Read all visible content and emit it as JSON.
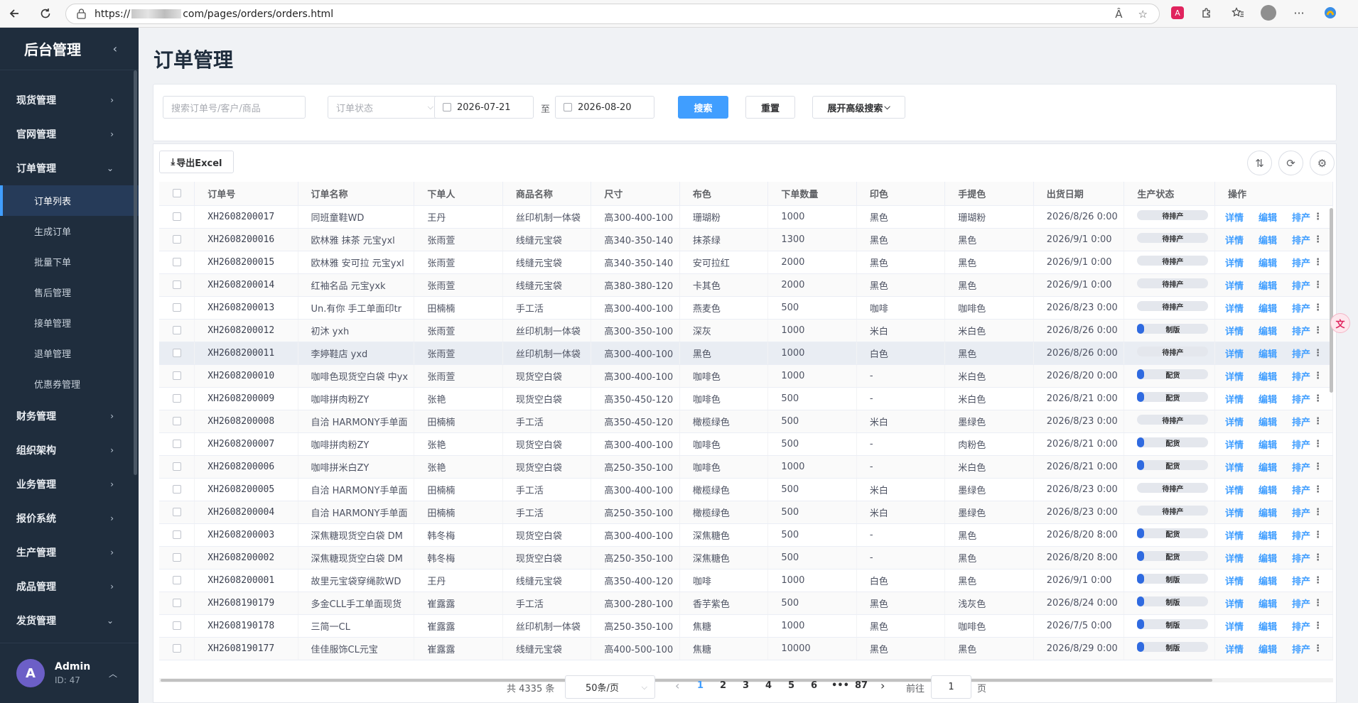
{
  "browser": {
    "url_prefix": "https://",
    "url_suffix": "com/pages/orders/orders.html",
    "read_aloud": "Â",
    "favorite": "☆",
    "more": "···"
  },
  "sidebar": {
    "title": "后台管理",
    "menu": [
      {
        "label": "现货管理",
        "arrow": "›"
      },
      {
        "label": "官网管理",
        "arrow": "›"
      },
      {
        "label": "订单管理",
        "arrow": "⌄"
      }
    ],
    "submenu": [
      "订单列表",
      "生成订单",
      "批量下单",
      "售后管理",
      "接单管理",
      "退单管理",
      "优惠券管理"
    ],
    "menu2": [
      {
        "label": "财务管理",
        "arrow": "›"
      },
      {
        "label": "组织架构",
        "arrow": "›"
      },
      {
        "label": "业务管理",
        "arrow": "›"
      },
      {
        "label": "报价系统",
        "arrow": "›"
      },
      {
        "label": "生产管理",
        "arrow": "›"
      },
      {
        "label": "成品管理",
        "arrow": "›"
      },
      {
        "label": "发货管理",
        "arrow": "⌄"
      }
    ],
    "user": {
      "initial": "A",
      "name": "Admin",
      "id": "ID: 47"
    }
  },
  "page": {
    "title": "订单管理"
  },
  "search": {
    "keyword_placeholder": "搜索订单号/客户/商品",
    "status_placeholder": "订单状态",
    "date_from": "2026-07-21",
    "to_label": "至",
    "date_to": "2026-08-20",
    "search_btn": "搜索",
    "reset_btn": "重置",
    "advanced_btn": "展开高级搜索"
  },
  "toolbar": {
    "export_label": "导出Excel"
  },
  "table": {
    "headers": [
      "订单号",
      "订单名称",
      "下单人",
      "商品名称",
      "尺寸",
      "布色",
      "下单数量",
      "印色",
      "手提色",
      "出货日期",
      "生产状态",
      "操作"
    ],
    "ops": [
      "详情",
      "编辑",
      "排产"
    ],
    "rows": [
      [
        "XH2608200017",
        "同班童鞋WD",
        "王丹",
        "丝印机制一体袋",
        "高300-400-100",
        "珊瑚粉",
        "1000",
        "黑色",
        "珊瑚粉",
        "2026/8/26 0:00",
        "待排产",
        0
      ],
      [
        "XH2608200016",
        "欧林雅 抹茶 元宝yxl",
        "张雨萱",
        "线缝元宝袋",
        "高340-350-140",
        "抹茶绿",
        "1300",
        "黑色",
        "黑色",
        "2026/9/1 0:00",
        "待排产",
        0
      ],
      [
        "XH2608200015",
        "欧林雅 安可拉 元宝yxl",
        "张雨萱",
        "线缝元宝袋",
        "高340-350-140",
        "安可拉红",
        "2000",
        "黑色",
        "黑色",
        "2026/9/1 0:00",
        "待排产",
        0
      ],
      [
        "XH2608200014",
        "红袖名品 元宝yxk",
        "张雨萱",
        "线缝元宝袋",
        "高380-380-120",
        "卡其色",
        "2000",
        "黑色",
        "黑色",
        "2026/9/1 0:00",
        "待排产",
        0
      ],
      [
        "XH2608200013",
        "Un.有你 手工单面印tr",
        "田楠楠",
        "手工活",
        "高300-400-100",
        "燕麦色",
        "500",
        "咖啡",
        "咖啡色",
        "2026/8/23 0:00",
        "待排产",
        0
      ],
      [
        "XH2608200012",
        "初沐 yxh",
        "张雨萱",
        "丝印机制一体袋",
        "高300-350-100",
        "深灰",
        "1000",
        "米白",
        "米白色",
        "2026/8/26 0:00",
        "制版",
        0.1
      ],
      [
        "XH2608200011",
        "李婷鞋店 yxd",
        "张雨萱",
        "丝印机制一体袋",
        "高300-400-100",
        "黑色",
        "1000",
        "白色",
        "黑色",
        "2026/8/26 0:00",
        "待排产",
        0
      ],
      [
        "XH2608200010",
        "咖啡色现货空白袋 中yx",
        "张雨萱",
        "现货空白袋",
        "高300-400-100",
        "咖啡色",
        "1000",
        "-",
        "米白色",
        "2026/8/20 0:00",
        "配货",
        0.1
      ],
      [
        "XH2608200009",
        "咖啡拼肉粉ZY",
        "张艳",
        "现货空白袋",
        "高350-450-120",
        "咖啡色",
        "500",
        "-",
        "米白色",
        "2026/8/21 0:00",
        "配货",
        0.1
      ],
      [
        "XH2608200008",
        "自洽 HARMONY手单面",
        "田楠楠",
        "手工活",
        "高350-450-120",
        "橄榄绿色",
        "500",
        "米白",
        "墨绿色",
        "2026/8/23 0:00",
        "待排产",
        0
      ],
      [
        "XH2608200007",
        "咖啡拼肉粉ZY",
        "张艳",
        "现货空白袋",
        "高300-400-100",
        "咖啡色",
        "500",
        "-",
        "肉粉色",
        "2026/8/21 0:00",
        "配货",
        0.1
      ],
      [
        "XH2608200006",
        "咖啡拼米白ZY",
        "张艳",
        "现货空白袋",
        "高250-350-100",
        "咖啡色",
        "1000",
        "-",
        "米白色",
        "2026/8/21 0:00",
        "配货",
        0.1
      ],
      [
        "XH2608200005",
        "自洽 HARMONY手单面",
        "田楠楠",
        "手工活",
        "高300-400-100",
        "橄榄绿色",
        "500",
        "米白",
        "墨绿色",
        "2026/8/23 0:00",
        "待排产",
        0
      ],
      [
        "XH2608200004",
        "自洽 HARMONY手单面",
        "田楠楠",
        "手工活",
        "高250-350-100",
        "橄榄绿色",
        "500",
        "米白",
        "墨绿色",
        "2026/8/23 0:00",
        "待排产",
        0
      ],
      [
        "XH2608200003",
        "深焦糖现货空白袋 DM",
        "韩冬梅",
        "现货空白袋",
        "高300-400-100",
        "深焦糖色",
        "500",
        "-",
        "黑色",
        "2026/8/20 8:00",
        "配货",
        0.1
      ],
      [
        "XH2608200002",
        "深焦糖现货空白袋 DM",
        "韩冬梅",
        "现货空白袋",
        "高250-350-100",
        "深焦糖色",
        "500",
        "-",
        "黑色",
        "2026/8/20 8:00",
        "配货",
        0.1
      ],
      [
        "XH2608200001",
        "故里元宝袋穿绳款WD",
        "王丹",
        "线缝元宝袋",
        "高350-400-120",
        "咖啡",
        "1000",
        "白色",
        "黑色",
        "2026/9/1 0:00",
        "制版",
        0.1
      ],
      [
        "XH2608190179",
        "多金CLL手工单面现货",
        "崔露露",
        "手工活",
        "高300-280-100",
        "香芋紫色",
        "500",
        "黑色",
        "浅灰色",
        "2026/8/24 0:00",
        "制版",
        0.1
      ],
      [
        "XH2608190178",
        "三简一CL",
        "崔露露",
        "丝印机制一体袋",
        "高250-350-100",
        "焦糖",
        "1000",
        "黑色",
        "咖啡色",
        "2026/7/5 0:00",
        "制版",
        0.1
      ],
      [
        "XH2608190177",
        "佳佳服饰CL元宝",
        "崔露露",
        "线缝元宝袋",
        "高400-500-100",
        "焦糖",
        "10000",
        "黑色",
        "黑色",
        "2026/8/29 0:00",
        "制版",
        0.1
      ]
    ]
  },
  "pagination": {
    "total": "共 4335 条",
    "page_size": "50条/页",
    "pages": [
      "1",
      "2",
      "3",
      "4",
      "5",
      "6",
      "•••",
      "87"
    ],
    "goto_label": "前往",
    "goto_value": "1",
    "page_suffix": "页"
  },
  "colors": {
    "primary": "#409eff",
    "sidebar_bg": "#1f2d3d",
    "status_fill": "#2f6ae0"
  }
}
